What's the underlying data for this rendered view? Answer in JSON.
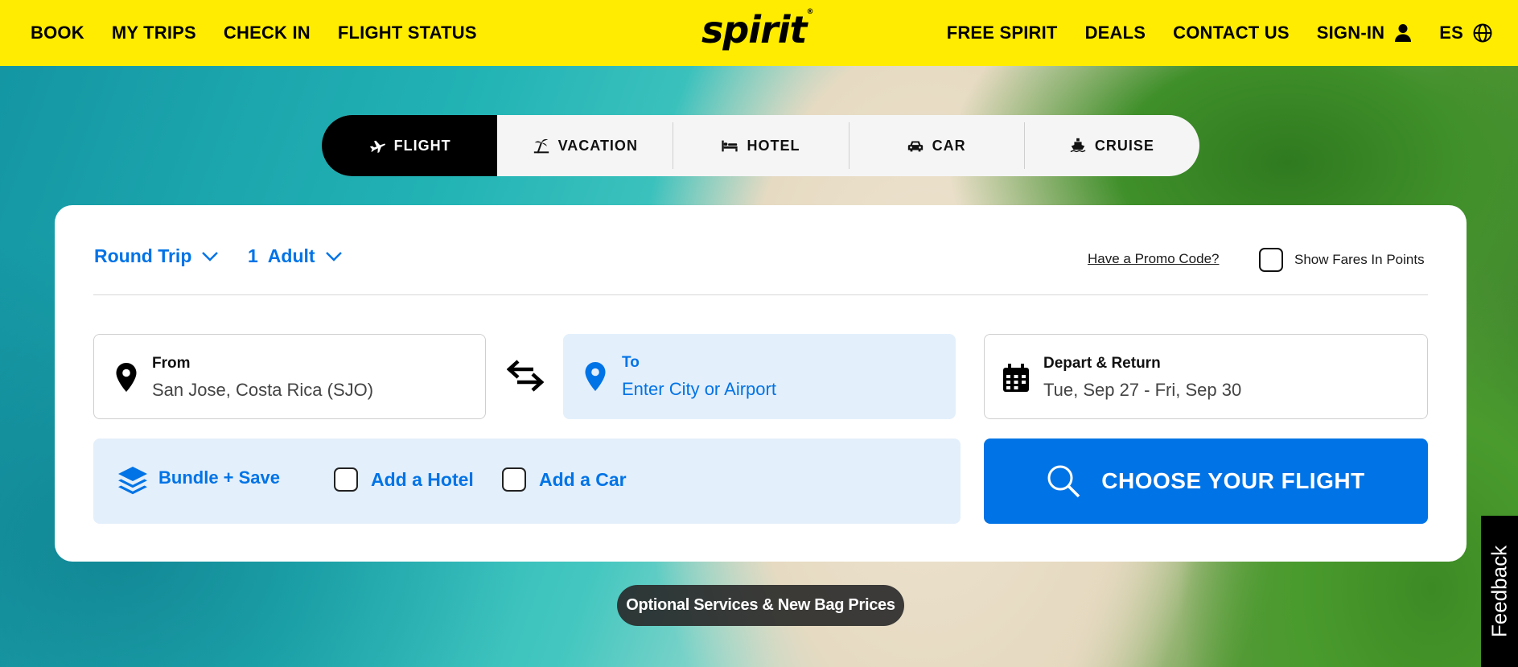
{
  "header": {
    "logo_text": "spirit",
    "left_nav": [
      "BOOK",
      "MY TRIPS",
      "CHECK IN",
      "FLIGHT STATUS"
    ],
    "right_nav": {
      "free_spirit": "FREE SPIRIT",
      "deals": "DEALS",
      "contact": "CONTACT US",
      "sign_in": "SIGN-IN",
      "language": "ES"
    },
    "background_color": "#ffec00"
  },
  "tabs": [
    {
      "label": "FLIGHT",
      "icon": "airplane-icon",
      "active": true
    },
    {
      "label": "VACATION",
      "icon": "beach-icon",
      "active": false
    },
    {
      "label": "HOTEL",
      "icon": "bed-icon",
      "active": false
    },
    {
      "label": "CAR",
      "icon": "car-icon",
      "active": false
    },
    {
      "label": "CRUISE",
      "icon": "ship-icon",
      "active": false
    }
  ],
  "booking": {
    "trip_type": "Round Trip",
    "passengers_count": "1",
    "passengers_label": "Adult",
    "promo_link": "Have a Promo Code?",
    "show_points_label": "Show Fares In Points",
    "from": {
      "label": "From",
      "value": "San Jose, Costa Rica (SJO)"
    },
    "to": {
      "label": "To",
      "placeholder": "Enter City or Airport"
    },
    "dates": {
      "label": "Depart & Return",
      "value": "Tue, Sep 27 - Fri, Sep 30"
    },
    "bundle": {
      "label": "Bundle + Save",
      "add_hotel": "Add a Hotel",
      "add_car": "Add a Car"
    },
    "search_button": "CHOOSE YOUR FLIGHT",
    "accent_color": "#0073e6"
  },
  "banner": {
    "label": "Optional Services & New Bag Prices"
  },
  "feedback": {
    "label": "Feedback"
  }
}
